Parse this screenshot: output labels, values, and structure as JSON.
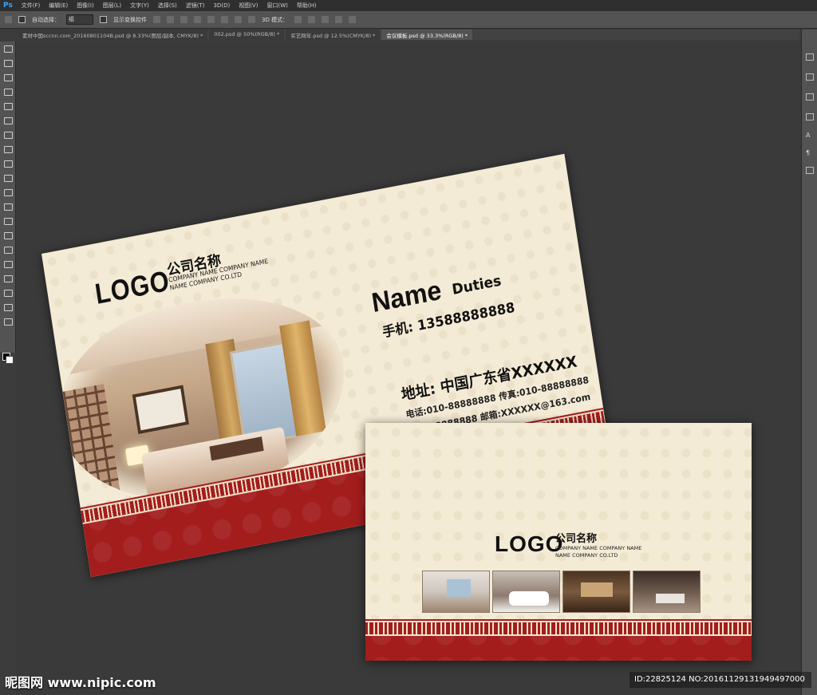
{
  "menubar": {
    "app_badge": "Ps",
    "items": [
      "文件(F)",
      "编辑(E)",
      "图像(I)",
      "图层(L)",
      "文字(Y)",
      "选择(S)",
      "滤镜(T)",
      "3D(D)",
      "视图(V)",
      "窗口(W)",
      "帮助(H)"
    ]
  },
  "options": {
    "auto_select_label": "自动选择：",
    "auto_select_value": "组",
    "show_transform_label": "显示变换控件",
    "mode_3d_label": "3D 模式："
  },
  "tabs": [
    "素材中国sccnn.com_20160801104B.psd @ 8.33%(图层/副本, CMYK/8) *",
    "002.psd @ 50%(RGB/8) *",
    "买艺网年.psd @ 12.5%(CMYK/8) *",
    "会议模板.psd @ 33.3%(RGB/8) *"
  ],
  "card_front": {
    "logo": "LOGO",
    "company_name_cn": "公司名称",
    "company_name_en_1": "COMPANY NAME COMPANY NAME",
    "company_name_en_2": "NAME COMPANY CO.LTD",
    "name": "Name",
    "duties": "Duties",
    "mobile": "手机:  13588888888",
    "address": "地址:  中国广东省XXXXXX",
    "phone_fax": "电话:010-88888888  传真:010-88888888",
    "qq_email": "Q Q:88888888  邮箱:XXXXXX@163.com"
  },
  "card_back": {
    "logo": "LOGO",
    "company_name_cn": "公司名称",
    "company_name_en_1": "COMPANY NAME COMPANY NAME",
    "company_name_en_2": "NAME COMPANY CO.LTD"
  },
  "watermark": {
    "site": "昵图网 www.nipic.com",
    "id_text": "ID:22825124 NO:20161129131949497000"
  },
  "colors": {
    "card_background": "#f4ebd6",
    "band_red": "#a31d1d",
    "workspace": "#3c3c3c"
  }
}
